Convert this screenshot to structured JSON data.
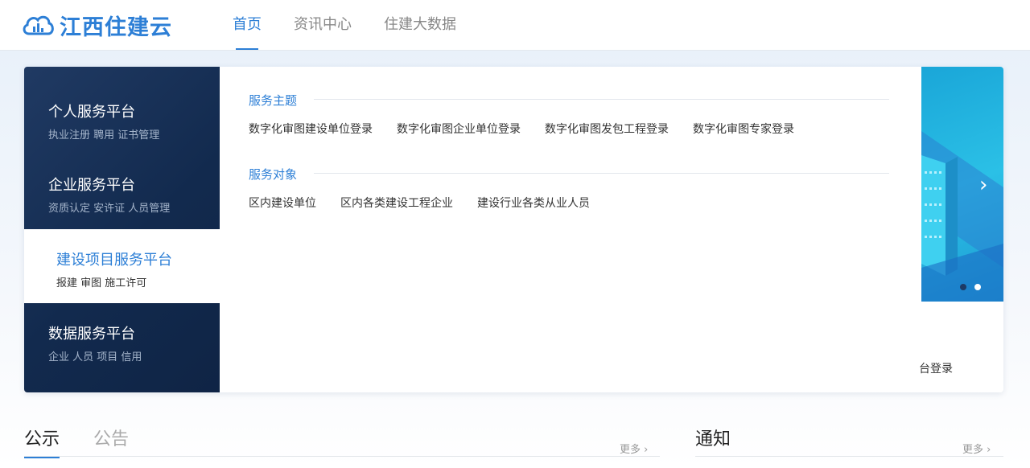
{
  "header": {
    "logo_text": "江西住建云",
    "nav": [
      {
        "label": "首页",
        "active": true
      },
      {
        "label": "资讯中心",
        "active": false
      },
      {
        "label": "住建大数据",
        "active": false
      }
    ]
  },
  "platforms": [
    {
      "title": "个人服务平台",
      "sub": "执业注册  聘用  证书管理"
    },
    {
      "title": "企业服务平台",
      "sub": "资质认定  安许证  人员管理"
    },
    {
      "title": "建设项目服务平台",
      "sub": "报建  审图  施工许可",
      "active": true
    },
    {
      "title": "数据服务平台",
      "sub": "企业  人员  项目  信用"
    }
  ],
  "dropdown": {
    "themes_title": "服务主题",
    "themes": [
      "数字化审图建设单位登录",
      "数字化审图企业单位登录",
      "数字化审图发包工程登录",
      "数字化审图专家登录"
    ],
    "targets_title": "服务对象",
    "targets": [
      "区内建设单位",
      "区内各类建设工程企业",
      "建设行业各类从业人员"
    ]
  },
  "banner": {
    "partial_text": "台登录"
  },
  "bottom": {
    "tabs": [
      {
        "label": "公示",
        "active": true
      },
      {
        "label": "公告",
        "active": false
      }
    ],
    "more_label": "更多 ›",
    "notice_title": "通知",
    "notice_more_label": "更多 ›"
  },
  "colors": {
    "accent": "#2d7fd6",
    "dark_panel": "#122a4e"
  }
}
